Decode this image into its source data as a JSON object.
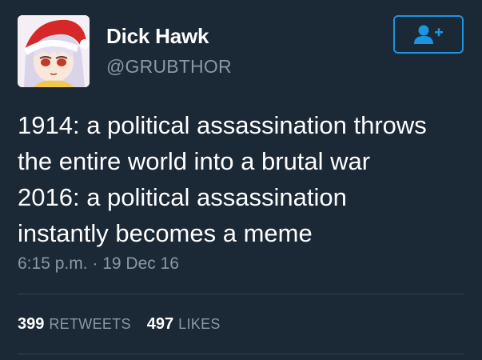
{
  "user": {
    "display_name": "Dick Hawk",
    "handle": "@GRUBTHOR",
    "avatar_icon": "anime-avatar-santa-hat"
  },
  "follow_button": {
    "icon": "add-user-icon"
  },
  "tweet": {
    "lines": [
      "1914: a political assassination throws",
      "the entire world into a brutal war",
      "2016: a political assassination",
      "instantly becomes a meme"
    ],
    "timestamp": "6:15 p.m. · 19 Dec 16"
  },
  "stats": {
    "retweets": {
      "count": "399",
      "label": "RETWEETS"
    },
    "likes": {
      "count": "497",
      "label": "LIKES"
    }
  },
  "colors": {
    "background": "#1b2836",
    "accent": "#1b95e0",
    "muted_text": "#8899a6",
    "divider": "#38444d"
  }
}
